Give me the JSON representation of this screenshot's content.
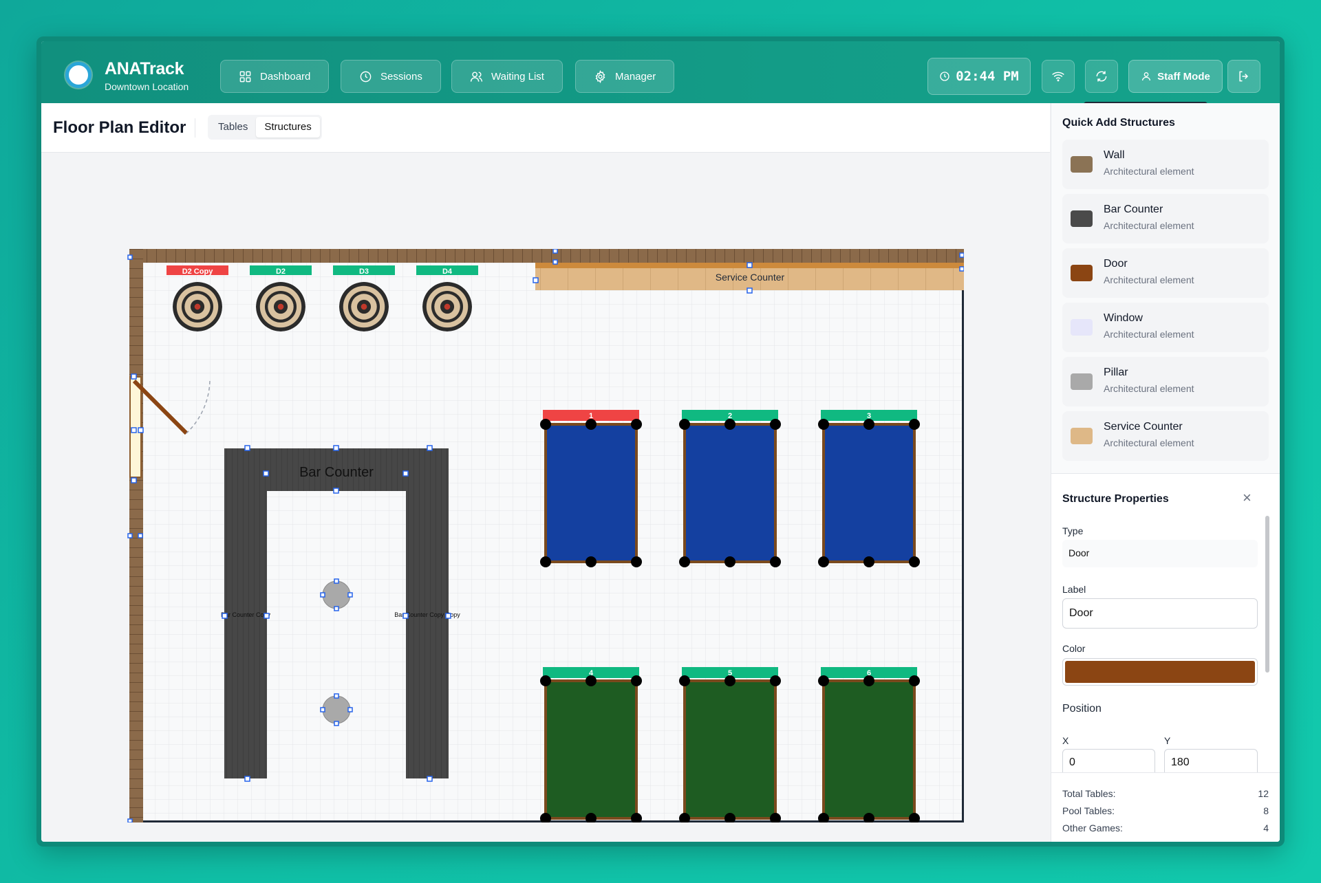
{
  "app": {
    "name": "ANATrack",
    "location": "Downtown Location"
  },
  "nav": [
    {
      "label": "Dashboard",
      "icon": "grid-icon"
    },
    {
      "label": "Sessions",
      "icon": "clock-icon"
    },
    {
      "label": "Waiting List",
      "icon": "users-icon"
    },
    {
      "label": "Manager",
      "icon": "gear-icon"
    }
  ],
  "header": {
    "time": "02:44 PM",
    "staff_label": "Staff Mode"
  },
  "editor": {
    "title": "Floor Plan Editor",
    "tabs": [
      "Tables",
      "Structures"
    ],
    "active_tab": "Structures"
  },
  "floor": {
    "dartboards": [
      "D2 Copy",
      "D2",
      "D3",
      "D4"
    ],
    "service_counter": "Service Counter",
    "bar_counter": "Bar Counter",
    "bar_side_labels": [
      "Bar Counter Copy",
      "Bar Counter Copy Copy"
    ],
    "pool_tables": [
      "1",
      "2",
      "3",
      "4",
      "5",
      "6"
    ],
    "colors": {
      "wood": "#8b5a2b",
      "brick": "#8b6a4a",
      "counter": "#e0b886",
      "bar": "#474747",
      "blue_felt": "#1440a0",
      "green_felt": "#1e5c22",
      "label_green": "#10b981",
      "label_red": "#ef4444"
    }
  },
  "sidebar": {
    "quick_add_title": "Quick Add Structures",
    "items": [
      {
        "name": "Wall",
        "desc": "Architectural element",
        "color": "#8b7355"
      },
      {
        "name": "Bar Counter",
        "desc": "Architectural element",
        "color": "#4a4a4a"
      },
      {
        "name": "Door",
        "desc": "Architectural element",
        "color": "#8b4513"
      },
      {
        "name": "Window",
        "desc": "Architectural element",
        "color": "#e6e6fa"
      },
      {
        "name": "Pillar",
        "desc": "Architectural element",
        "color": "#a9a9a9"
      },
      {
        "name": "Service Counter",
        "desc": "Architectural element",
        "color": "#deb887"
      }
    ],
    "props": {
      "title": "Structure Properties",
      "type_label": "Type",
      "type_value": "Door",
      "label_label": "Label",
      "label_value": "Door",
      "color_label": "Color",
      "color_value": "#8b4513",
      "position_label": "Position",
      "x_label": "X",
      "x_value": "0",
      "y_label": "Y",
      "y_value": "180"
    },
    "stats": [
      {
        "label": "Total Tables:",
        "value": "12"
      },
      {
        "label": "Pool Tables:",
        "value": "8"
      },
      {
        "label": "Other Games:",
        "value": "4"
      }
    ]
  }
}
